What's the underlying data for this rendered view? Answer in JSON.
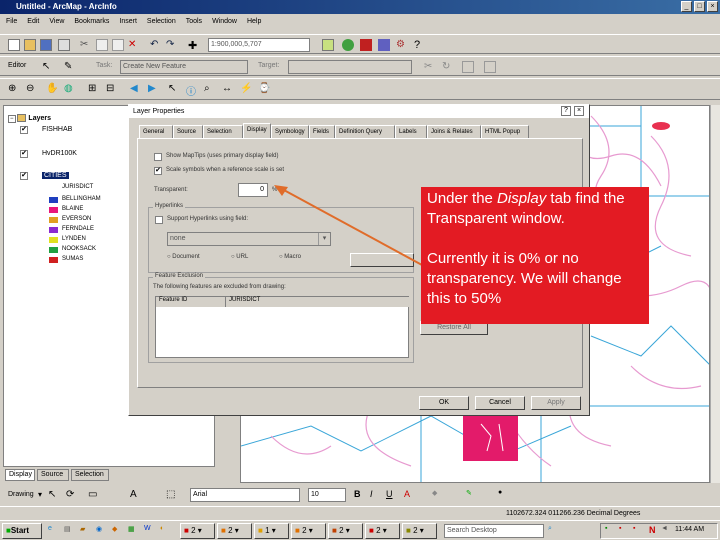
{
  "window": {
    "title": "Untitled - ArcMap - ArcInfo"
  },
  "menu": [
    "File",
    "Edit",
    "View",
    "Bookmarks",
    "Insert",
    "Selection",
    "Tools",
    "Window",
    "Help"
  ],
  "toolbar": {
    "scale": "1:900,000,5,707"
  },
  "editor": {
    "label": "Editor",
    "task_label": "Task:",
    "task_value": "Create New Feature",
    "target_label": "Target:"
  },
  "toc": {
    "root": "Layers",
    "layers": [
      "FISHHAB",
      "HvDR100K",
      "CITIES"
    ],
    "field": "JURISDICT",
    "classes": [
      {
        "name": "BELLINGHAM",
        "color": "#1f3fbf"
      },
      {
        "name": "BLAINE",
        "color": "#e8167a"
      },
      {
        "name": "EVERSON",
        "color": "#e0a020"
      },
      {
        "name": "FERNDALE",
        "color": "#8a2ad0"
      },
      {
        "name": "LYNDEN",
        "color": "#e0e020"
      },
      {
        "name": "NOOKSACK",
        "color": "#20a040"
      },
      {
        "name": "SUMAS",
        "color": "#d02020"
      }
    ],
    "tabs": [
      "Display",
      "Source",
      "Selection"
    ]
  },
  "dialog": {
    "title": "Layer Properties",
    "tabs": [
      "General",
      "Source",
      "Selection",
      "Display",
      "Symbology",
      "Fields",
      "Definition Query",
      "Labels",
      "Joins & Relates",
      "HTML Popup"
    ],
    "active_tab": "Display",
    "show_maptips": "Show MapTips (uses primary display field)",
    "scale_symbols": "Scale symbols when a reference scale is set",
    "transparent_label": "Transparent:",
    "transparent_value": "0",
    "transparent_unit": "%",
    "hyperlinks_group": "Hyperlinks",
    "support_hyperlinks": "Support Hyperlinks using field:",
    "hyperlink_field": "none",
    "opt_document": "Document",
    "opt_url": "URL",
    "opt_macro": "Macro",
    "exclusion_group": "Feature Exclusion",
    "exclusion_text": "The following features are excluded from drawing:",
    "col_feature": "Feature ID",
    "col_jurisdict": "JURISDICT",
    "restore_all": "Restore All",
    "ok": "OK",
    "cancel": "Cancel",
    "apply": "Apply"
  },
  "callout": {
    "line1_pre": "Under the ",
    "line1_em": "Display",
    "line1_post": " tab find the Transparent window.",
    "line2": "Currently it is 0% or no transparency.  We will change this to 50%"
  },
  "drawing": {
    "label": "Drawing",
    "font": "Arial",
    "size": "10"
  },
  "status": {
    "coords": "1102672.324  011266.236 Decimal Degrees"
  },
  "taskbar": {
    "start": "Start",
    "search_placeholder": "Search Desktop",
    "time": "11:44 AM",
    "tasks": [
      "2",
      "2",
      "1",
      "2",
      "2",
      "2",
      "2"
    ]
  },
  "colors": {
    "callout": "#e31b23",
    "map_line_blue": "#3aa6d8",
    "map_line_pink": "#e79ad0"
  }
}
